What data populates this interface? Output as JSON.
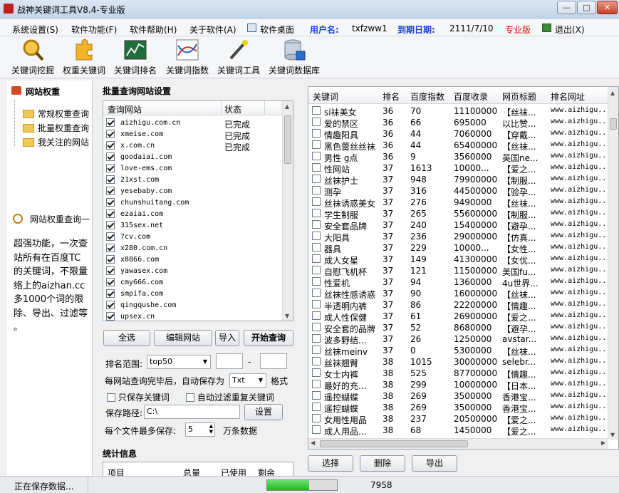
{
  "window": {
    "title": "战神关键词工具V8.4-专业版",
    "min": "—",
    "max": "□",
    "close": "✕"
  },
  "menu": {
    "items": [
      "系统设置(S)",
      "软件功能(F)",
      "软件帮助(H)",
      "关于软件(A)",
      "软件桌面"
    ],
    "username_label": "用户名:",
    "username": "txfzww1",
    "expiry_label": "到期日期:",
    "expiry": "2111/7/10",
    "edition": "专业版",
    "logout": "退出(X)"
  },
  "toolbar": [
    "关键词挖掘",
    "权重关键词",
    "关键词排名",
    "关键词指数",
    "关键词工具",
    "关键词数据库"
  ],
  "left": {
    "header": "网站权重",
    "tree": [
      "常规权重查询",
      "批量权重查询",
      "我关注的网站"
    ],
    "info_header": "网站权重查询一",
    "desc_lines": [
      "超强功能，一次查",
      "站所有在百度TC",
      "的关键词，不限量",
      "络上的aizhan.cc",
      "多1000个词的限",
      "除、导出、过滤等",
      "。"
    ]
  },
  "batch": {
    "group_title": "批量查询网站设置",
    "col_site": "查询网站",
    "col_status": "状态",
    "sites": [
      {
        "site": "aizhigu.com.cn",
        "status": "已完成"
      },
      {
        "site": "xmeise.com",
        "status": "已完成"
      },
      {
        "site": "x.com.cn",
        "status": "已完成"
      },
      {
        "site": "goodaiai.com",
        "status": ""
      },
      {
        "site": "love-ems.com",
        "status": ""
      },
      {
        "site": "21xst.com",
        "status": ""
      },
      {
        "site": "yesebaby.com",
        "status": ""
      },
      {
        "site": "chunshuitang.com",
        "status": ""
      },
      {
        "site": "ezaiai.com",
        "status": ""
      },
      {
        "site": "315sex.net",
        "status": ""
      },
      {
        "site": "7cv.com",
        "status": ""
      },
      {
        "site": "x280.com.cn",
        "status": ""
      },
      {
        "site": "x8866.com",
        "status": ""
      },
      {
        "site": "yawasex.com",
        "status": ""
      },
      {
        "site": "cmy666.com",
        "status": ""
      },
      {
        "site": "smpifa.com",
        "status": ""
      },
      {
        "site": "qingqushe.com",
        "status": ""
      },
      {
        "site": "upsex.cn",
        "status": ""
      }
    ],
    "btn_select_all": "全选",
    "btn_edit": "编辑网站",
    "btn_import": "导入",
    "btn_start": "开始查询",
    "rank_label": "排名范围:",
    "rank_value": "top50",
    "range_dash": "-",
    "autosave_text": "每网站查询完毕后，自动保存为",
    "format_value": "Txt",
    "format_label": "格式",
    "only_keywords": "只保存关键词",
    "auto_filter": "自动过滤重复关键词",
    "path_label": "保存路径:",
    "path_value": "C:\\",
    "btn_settings": "设置",
    "max_label": "每个文件最多保存:",
    "max_value": "5",
    "max_unit": "万条数据"
  },
  "stats": {
    "title": "统计信息",
    "cols": [
      "项目",
      "总量",
      "已使用",
      "剩余"
    ]
  },
  "results": {
    "headers": [
      "关键词",
      "排名",
      "百度指数",
      "百度收录",
      "网页标题",
      "排名网址"
    ],
    "rows": [
      [
        "si袜美女",
        "36",
        "70",
        "11100000",
        "【丝袜...",
        "www.aizhigu..."
      ],
      [
        "爱的禁区",
        "36",
        "66",
        "695000",
        "以比赞...",
        "www.aizhigu..."
      ],
      [
        "情趣阳具",
        "36",
        "44",
        "7060000",
        "【穿戴...",
        "www.aizhigu..."
      ],
      [
        "黑色蕾丝丝袜",
        "36",
        "44",
        "65400000",
        "【丝袜...",
        "www.aizhigu..."
      ],
      [
        "男性 g点",
        "36",
        "9",
        "3560000",
        "英国ne...",
        "www.aizhigu..."
      ],
      [
        "性网站",
        "37",
        "1613",
        "10000...",
        "【爱之...",
        "www.aizhigu..."
      ],
      [
        "丝袜护士",
        "37",
        "948",
        "79900000",
        "【制服...",
        "www.aizhigu..."
      ],
      [
        "测孕",
        "37",
        "316",
        "44500000",
        "【验孕...",
        "www.aizhigu..."
      ],
      [
        "丝袜诱惑美女",
        "37",
        "276",
        "9490000",
        "【丝袜...",
        "www.aizhigu..."
      ],
      [
        "学生制服",
        "37",
        "265",
        "55600000",
        "【制服...",
        "www.aizhigu..."
      ],
      [
        "安全套品牌",
        "37",
        "240",
        "15400000",
        "【避孕...",
        "www.aizhigu..."
      ],
      [
        "大阳具",
        "37",
        "236",
        "29000000",
        "【仿真...",
        "www.aizhigu..."
      ],
      [
        "器具",
        "37",
        "229",
        "10000...",
        "【女性...",
        "www.aizhigu..."
      ],
      [
        "成人女星",
        "37",
        "149",
        "41300000",
        "【女优...",
        "www.aizhigu..."
      ],
      [
        "自慰飞机杯",
        "37",
        "121",
        "11500000",
        "美国fu...",
        "www.aizhigu..."
      ],
      [
        "性爱机",
        "37",
        "94",
        "1360000",
        "4u世界...",
        "www.aizhigu..."
      ],
      [
        "丝袜性感诱惑",
        "37",
        "90",
        "16000000",
        "【丝袜...",
        "www.aizhigu..."
      ],
      [
        "半透明内裤",
        "37",
        "86",
        "22200000",
        "【情趣...",
        "www.aizhigu..."
      ],
      [
        "成人性保健",
        "37",
        "61",
        "26900000",
        "【爱之...",
        "www.aizhigu..."
      ],
      [
        "安全套的品牌",
        "37",
        "52",
        "8680000",
        "【避孕...",
        "www.aizhigu..."
      ],
      [
        "波多野结...",
        "37",
        "26",
        "1250000",
        "avstar...",
        "www.aizhigu..."
      ],
      [
        "丝袜meinv",
        "37",
        "0",
        "5300000",
        "【丝袜...",
        "www.aizhigu..."
      ],
      [
        "丝袜翘臀",
        "38",
        "1015",
        "30000000",
        "selebr...",
        "www.aizhigu..."
      ],
      [
        "女士内裤",
        "38",
        "525",
        "87700000",
        "【情趣...",
        "www.aizhigu..."
      ],
      [
        "最好的充...",
        "38",
        "299",
        "10000000",
        "【日本...",
        "www.aizhigu..."
      ],
      [
        "遥控蝴蝶",
        "38",
        "269",
        "3500000",
        "香港宝...",
        "www.aizhigu..."
      ],
      [
        "遥控蝴蝶",
        "38",
        "269",
        "3500000",
        "香港宝...",
        "www.aizhigu..."
      ],
      [
        "女用性用品",
        "38",
        "237",
        "20500000",
        "【爱之...",
        "www.aizhigu..."
      ],
      [
        "成人用品...",
        "38",
        "68",
        "1450000",
        "【爱之...",
        "www.aizhigu..."
      ]
    ],
    "btn_select": "选择",
    "btn_delete": "删除",
    "btn_export": "导出"
  },
  "status": {
    "text": "正在保存数据...",
    "count": "7958",
    "progress": 0.6
  }
}
